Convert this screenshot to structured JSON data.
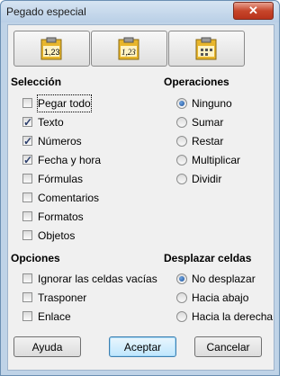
{
  "window": {
    "title": "Pegado especial",
    "close_label": "✕"
  },
  "presets": [
    {
      "name": "preset-values-only",
      "text": "1,23"
    },
    {
      "name": "preset-values-formats",
      "text": "1,23"
    },
    {
      "name": "preset-formats-only",
      "text": ""
    }
  ],
  "seleccion": {
    "title": "Selección",
    "items": [
      {
        "label": "Pegar todo",
        "checked": false
      },
      {
        "label": "Texto",
        "checked": true
      },
      {
        "label": "Números",
        "checked": true
      },
      {
        "label": "Fecha y hora",
        "checked": true
      },
      {
        "label": "Fórmulas",
        "checked": false
      },
      {
        "label": "Comentarios",
        "checked": false
      },
      {
        "label": "Formatos",
        "checked": false
      },
      {
        "label": "Objetos",
        "checked": false
      }
    ]
  },
  "operaciones": {
    "title": "Operaciones",
    "items": [
      {
        "label": "Ninguno",
        "selected": true
      },
      {
        "label": "Sumar",
        "selected": false
      },
      {
        "label": "Restar",
        "selected": false
      },
      {
        "label": "Multiplicar",
        "selected": false
      },
      {
        "label": "Dividir",
        "selected": false
      }
    ]
  },
  "opciones": {
    "title": "Opciones",
    "items": [
      {
        "label": "Ignorar las celdas vacías",
        "checked": false
      },
      {
        "label": "Trasponer",
        "checked": false
      },
      {
        "label": "Enlace",
        "checked": false
      }
    ]
  },
  "desplazar": {
    "title": "Desplazar celdas",
    "items": [
      {
        "label": "No desplazar",
        "selected": true
      },
      {
        "label": "Hacia abajo",
        "selected": false
      },
      {
        "label": "Hacia la derecha",
        "selected": false
      }
    ]
  },
  "buttons": {
    "help": "Ayuda",
    "ok": "Aceptar",
    "cancel": "Cancelar"
  }
}
